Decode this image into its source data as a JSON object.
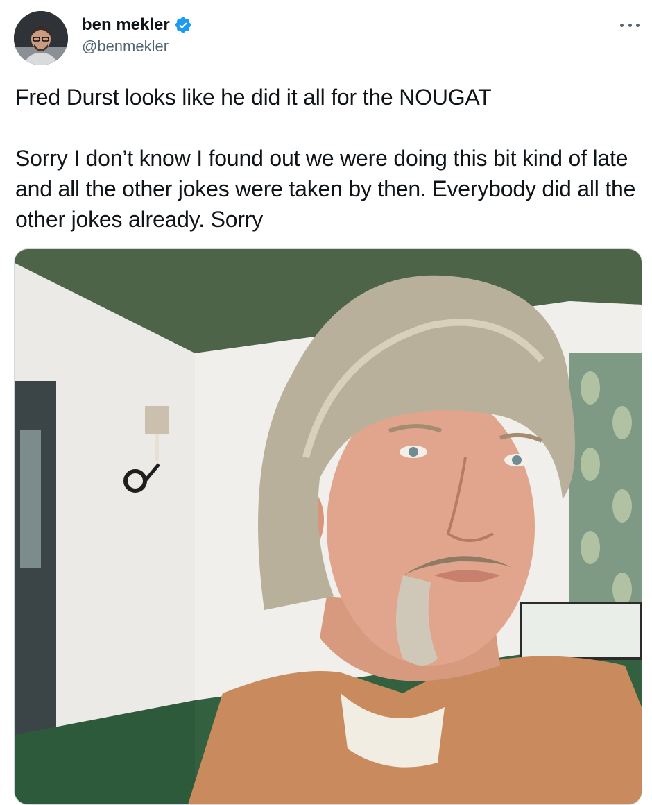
{
  "tweet": {
    "author": {
      "display_name": "ben mekler",
      "handle": "@benmekler",
      "verified": true,
      "verified_icon": "verified-badge-icon"
    },
    "more_icon": "more-horizontal-icon",
    "text": "Fred Durst looks like he did it all for the NOUGAT\n\nSorry I don’t know I found out we were doing this bit kind of late and all the other jokes were taken by then. Everybody did all the other jokes already. Sorry",
    "media": {
      "kind": "photo"
    }
  },
  "colors": {
    "text_primary": "#0f1419",
    "text_secondary": "#536471",
    "verified_blue": "#1d9bf0",
    "media_border": "#cfd9de"
  }
}
